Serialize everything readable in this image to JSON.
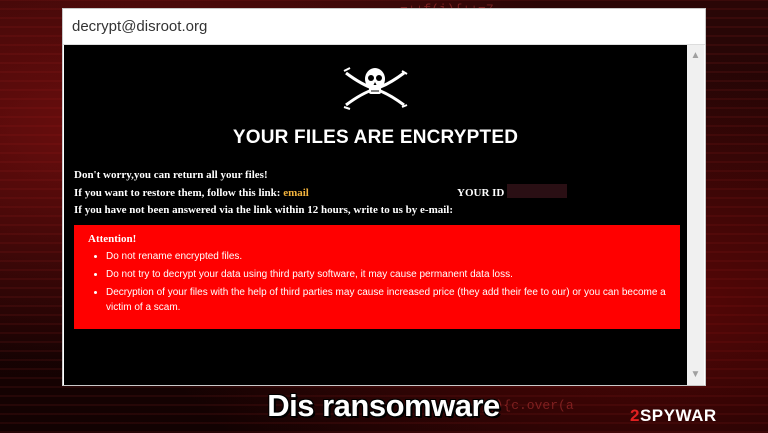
{
  "window": {
    "title": "decrypt@disroot.org"
  },
  "note": {
    "headline": "YOUR FILES ARE ENCRYPTED",
    "line1": "Don't worry,you can return all your files!",
    "line2_prefix": "If you want to restore them, follow this link: ",
    "line2_link": "email",
    "your_id_label": "YOUR ID",
    "line3": "If you have not been answered via the link within 12 hours, write to us by e-mail:",
    "attention_title": "Attention!",
    "attention_items": [
      "Do not rename encrypted files.",
      "Do not try to decrypt your data using third party software, it may cause permanent data loss.",
      "Decryption of your files with the help of third parties may cause increased price (they add their fee to our) or you can become a victim of a scam."
    ]
  },
  "caption": "Dis ransomware",
  "logo": {
    "two": "2",
    "rest": "SPYWAR"
  },
  "colors": {
    "attention_bg": "#ff0000",
    "link": "#f2b33d",
    "page_bg": "#000000"
  }
}
